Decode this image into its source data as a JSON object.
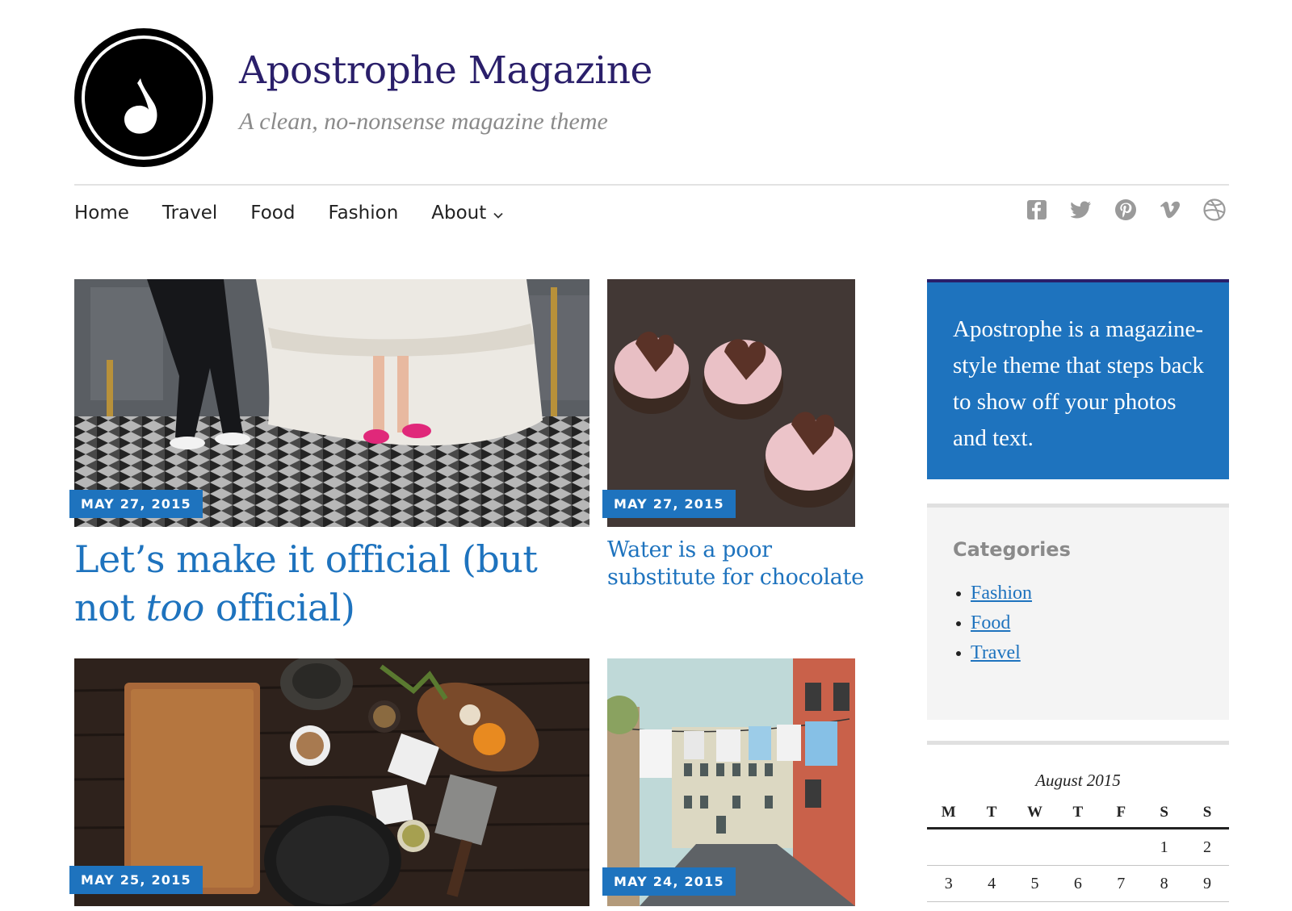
{
  "site": {
    "title": "Apostrophe Magazine",
    "tagline": "A clean, no-nonsense magazine theme"
  },
  "nav": {
    "items": [
      {
        "label": "Home"
      },
      {
        "label": "Travel"
      },
      {
        "label": "Food"
      },
      {
        "label": "Fashion"
      },
      {
        "label": "About",
        "has_submenu": true
      }
    ]
  },
  "social": [
    "facebook-icon",
    "twitter-icon",
    "pinterest-icon",
    "vimeo-icon",
    "dribbble-icon"
  ],
  "posts": [
    {
      "date": "MAY 27, 2015",
      "title_parts": [
        "Let’s make it official (but not ",
        "too",
        " official)"
      ],
      "image": "wedding-shoes-photo"
    },
    {
      "date": "MAY 27, 2015",
      "title": "Water is a poor substitute for chocolate",
      "image": "cupcakes-photo"
    },
    {
      "date": "MAY 25, 2015",
      "image": "kitchen-table-photo"
    },
    {
      "date": "MAY 24, 2015",
      "image": "street-laundry-photo"
    }
  ],
  "sidebar": {
    "about_text": "Apostrophe is a magazine-style theme that steps back to show off your photos and text.",
    "categories_title": "Categories",
    "categories": [
      "Fashion",
      "Food",
      "Travel"
    ],
    "calendar": {
      "caption": "August 2015",
      "headers": [
        "M",
        "T",
        "W",
        "T",
        "F",
        "S",
        "S"
      ],
      "rows": [
        [
          "",
          "",
          "",
          "",
          "",
          "1",
          "2"
        ],
        [
          "3",
          "4",
          "5",
          "6",
          "7",
          "8",
          "9"
        ]
      ]
    }
  },
  "colors": {
    "accent": "#1e73be",
    "title": "#2a1f6a",
    "muted": "#8a8a8a"
  }
}
